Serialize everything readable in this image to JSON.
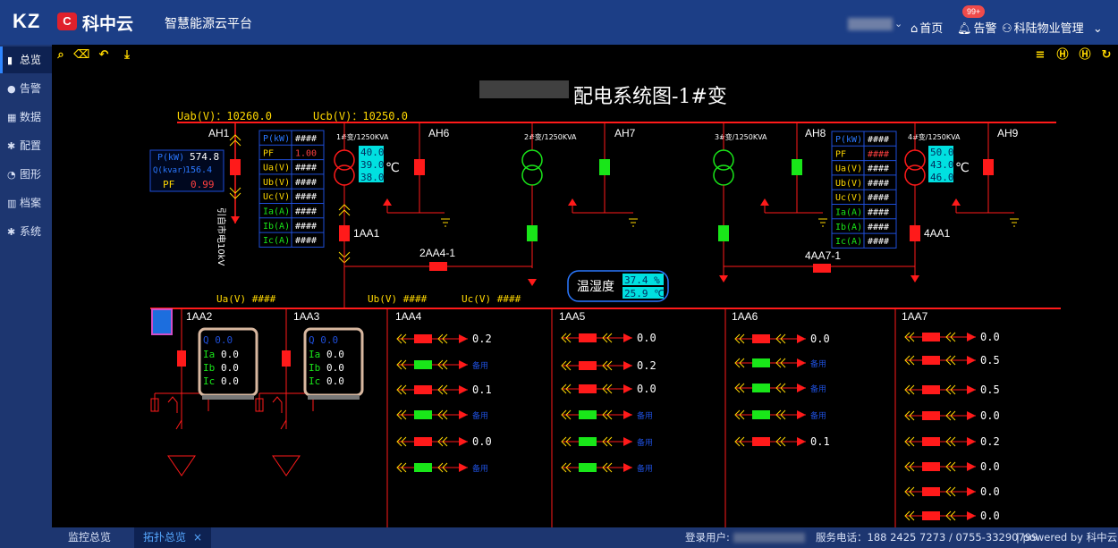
{
  "header": {
    "logo_text": "KZ",
    "logo_badge": "C",
    "brand": "科中云",
    "platform": "智慧能源云平台",
    "home": "首页",
    "alarm": "告警",
    "alarm_count": "99+",
    "account": "科陆物业管理"
  },
  "sidebar": {
    "items": [
      {
        "label": "总览",
        "icon": "bar-chart-icon"
      },
      {
        "label": "告警",
        "icon": "bell-icon"
      },
      {
        "label": "数据",
        "icon": "table-icon"
      },
      {
        "label": "配置",
        "icon": "gear-icon"
      },
      {
        "label": "图形",
        "icon": "chart-icon"
      },
      {
        "label": "档案",
        "icon": "archive-icon"
      },
      {
        "label": "系统",
        "icon": "gear-icon"
      }
    ]
  },
  "diagram": {
    "title": "配电系统图-1#变",
    "uab": "Uab(V)：10260.0",
    "ucb": "Ucb(V)：10250.0",
    "cabinets_top": [
      "AH1",
      "AH6",
      "AH7",
      "AH8",
      "AH9"
    ],
    "ah1_meter": {
      "p_label": "P(kW)",
      "p_value": "574.8",
      "q_label": "Q(kvar)",
      "q_value": "156.4",
      "pf_label": "PF",
      "pf_value": "0.99"
    },
    "ah1_incoming": "引自市电10kV",
    "transformers": [
      {
        "name": "1#变/1250KVA",
        "temps": [
          "40.0",
          "39.0",
          "38.0"
        ],
        "unit": "℃"
      },
      {
        "name": "2#变/1250KVA"
      },
      {
        "name": "3#变/1250KVA"
      },
      {
        "name": "4#变/1250KVA",
        "temps": [
          "50.0",
          "43.0",
          "46.0"
        ],
        "unit": "℃"
      }
    ],
    "param_table_1": [
      {
        "label": "P(kW)",
        "value": "####"
      },
      {
        "label": "PF",
        "value": "1.00"
      },
      {
        "label": "Ua(V)",
        "value": "####"
      },
      {
        "label": "Ub(V)",
        "value": "####"
      },
      {
        "label": "Uc(V)",
        "value": "####"
      },
      {
        "label": "Ia(A)",
        "value": "####"
      },
      {
        "label": "Ib(A)",
        "value": "####"
      },
      {
        "label": "Ic(A)",
        "value": "####"
      }
    ],
    "param_table_4": [
      {
        "label": "P(kW)",
        "value": "####"
      },
      {
        "label": "PF",
        "value": "####"
      },
      {
        "label": "Ua(V)",
        "value": "####"
      },
      {
        "label": "Ub(V)",
        "value": "####"
      },
      {
        "label": "Uc(V)",
        "value": "####"
      },
      {
        "label": "Ia(A)",
        "value": "####"
      },
      {
        "label": "Ib(A)",
        "value": "####"
      },
      {
        "label": "Ic(A)",
        "value": "####"
      }
    ],
    "breakers": {
      "main_1": "1AA1",
      "tie_1": "2AA4-1",
      "tie_2": "4AA7-1",
      "main_4": "4AA1"
    },
    "humidity": {
      "label": "温湿度",
      "humidity": "37.4 %",
      "temperature": "25.9 ℃"
    },
    "low_bus": {
      "ua": "Ua(V) ####",
      "ub": "Ub(V) ####",
      "uc": "Uc(V) ####"
    },
    "capacitor_panels": [
      {
        "name": "1AA2",
        "q": "Q 0.0",
        "ia": "0.0",
        "ib": "0.0",
        "ic": "0.0"
      },
      {
        "name": "1AA3",
        "q": "Q 0.0",
        "ia": "0.0",
        "ib": "0.0",
        "ic": "0.0"
      }
    ],
    "feeders": [
      {
        "name": "1AA4",
        "values": [
          "0.2",
          "备用",
          "0.1",
          "备用",
          "0.0",
          "备用"
        ]
      },
      {
        "name": "1AA5",
        "values": [
          "0.0",
          "0.2",
          "0.0",
          "备用",
          "备用",
          "备用"
        ]
      },
      {
        "name": "1AA6",
        "values": [
          "0.0",
          "备用",
          "备用",
          "备用",
          "0.1"
        ]
      },
      {
        "name": "1AA7",
        "values": [
          "0.0",
          "0.5",
          "0.5",
          "0.0",
          "0.2",
          "0.0",
          "0.0",
          "0.0"
        ]
      }
    ]
  },
  "bottom": {
    "tab_monitor": "监控总览",
    "tab_topology": "拓扑总览",
    "tab_close": "×",
    "login_user": "登录用户:",
    "service_phone": "服务电话：188 2425 7273 / 0755-33290799",
    "powered": "| powered by 科中云"
  }
}
